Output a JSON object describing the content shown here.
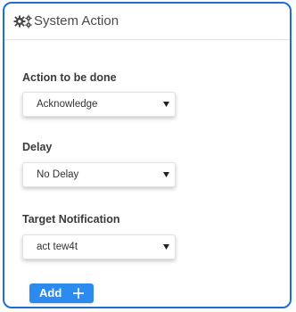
{
  "panel": {
    "title": "System Action",
    "icon": "gears-icon"
  },
  "fields": [
    {
      "label": "Action to be done",
      "value": "Acknowledge"
    },
    {
      "label": "Delay",
      "value": "No Delay"
    },
    {
      "label": "Target Notification",
      "value": "act tew4t"
    }
  ],
  "add_button": {
    "label": "Add",
    "icon": "plus-icon"
  },
  "colors": {
    "accent": "#2d8bf0",
    "panel_border": "#1f6fd1"
  }
}
